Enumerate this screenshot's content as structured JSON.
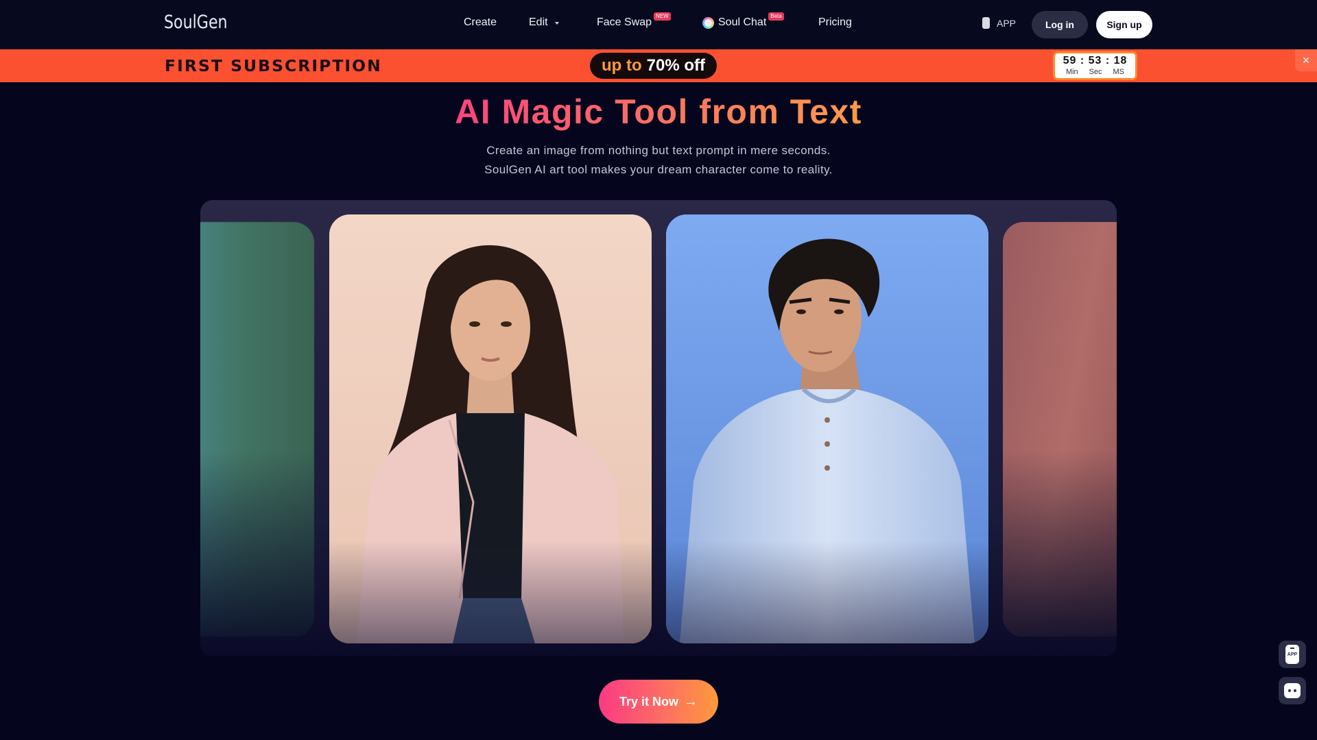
{
  "header": {
    "logo": "SoulGen",
    "nav": [
      {
        "label": "Create"
      },
      {
        "label": "Edit",
        "has_dropdown": true
      },
      {
        "label": "Face Swap",
        "badge": "NEW"
      },
      {
        "label": "Soul Chat",
        "badge": "Beta",
        "icon": "soul-chat-icon"
      },
      {
        "label": "Pricing"
      }
    ],
    "app_label": "APP",
    "login_label": "Log in",
    "signup_label": "Sign up"
  },
  "promo": {
    "title": "FIRST SUBSCRIPTION",
    "pill_prefix": "up to",
    "pill_value": "70% off",
    "timer": {
      "min": "59",
      "sec": "53",
      "ms": "18",
      "min_label": "Min",
      "sec_label": "Sec",
      "ms_label": "MS"
    },
    "close_icon": "×",
    "colors": {
      "background": "#fb5131",
      "timer_border": "#ff8a2b"
    }
  },
  "hero": {
    "title": "AI Magic Tool from Text",
    "subtitle_line1": "Create an image from nothing but text prompt in mere seconds.",
    "subtitle_line2": "SoulGen AI art tool makes your dream character come to reality."
  },
  "carousel": {
    "slides": [
      {
        "name": "blurred-left-slide",
        "description": "Blurred teal/green image"
      },
      {
        "name": "woman-portrait",
        "description": "Young woman with long dark hair, pink blazer, black top"
      },
      {
        "name": "man-portrait",
        "description": "Young man with dark hair in light blue henley shirt on blue background"
      },
      {
        "name": "blurred-right-slide",
        "description": "Blurred reddish image"
      }
    ]
  },
  "cta": {
    "label": "Try it Now",
    "arrow": "→"
  },
  "floating": {
    "app_label": "APP"
  },
  "colors": {
    "page_bg": "#05051e",
    "accent_pink": "#fc3a83",
    "accent_orange": "#ff9a3a"
  }
}
